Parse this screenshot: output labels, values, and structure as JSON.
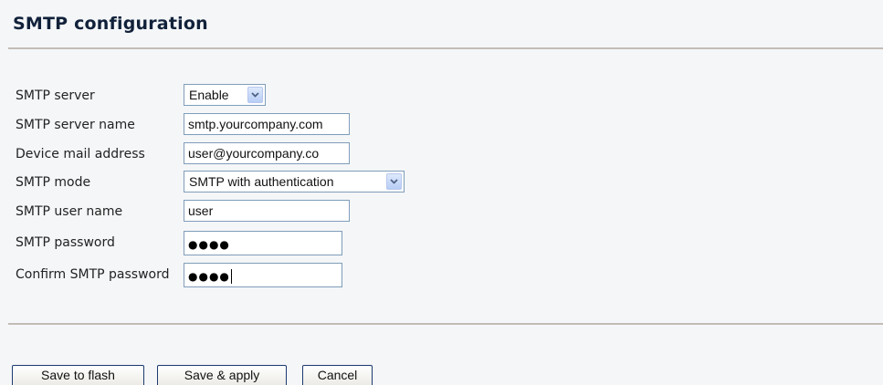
{
  "page": {
    "title": "SMTP configuration"
  },
  "form": {
    "smtp_server": {
      "label": "SMTP server",
      "value": "Enable"
    },
    "smtp_server_name": {
      "label": "SMTP server name",
      "value": "smtp.yourcompany.com"
    },
    "device_mail_address": {
      "label": "Device mail address",
      "value": "user@yourcompany.co"
    },
    "smtp_mode": {
      "label": "SMTP mode",
      "value": "SMTP with authentication"
    },
    "smtp_user_name": {
      "label": "SMTP user name",
      "value": "user"
    },
    "smtp_password": {
      "label": "SMTP password",
      "masked_value": "●●●●"
    },
    "confirm_smtp_password": {
      "label": "Confirm SMTP password",
      "masked_value": "●●●●"
    }
  },
  "buttons": {
    "save_to_flash": "Save to flash",
    "save_and_apply": "Save & apply",
    "cancel": "Cancel"
  },
  "icons": {
    "dropdown": "chevron-down-icon"
  },
  "colors": {
    "background": "#f4f6f8",
    "title": "#11213a",
    "input_border": "#7f9db9",
    "rule": "#c3bcb6",
    "button_border": "#1c3a70"
  }
}
